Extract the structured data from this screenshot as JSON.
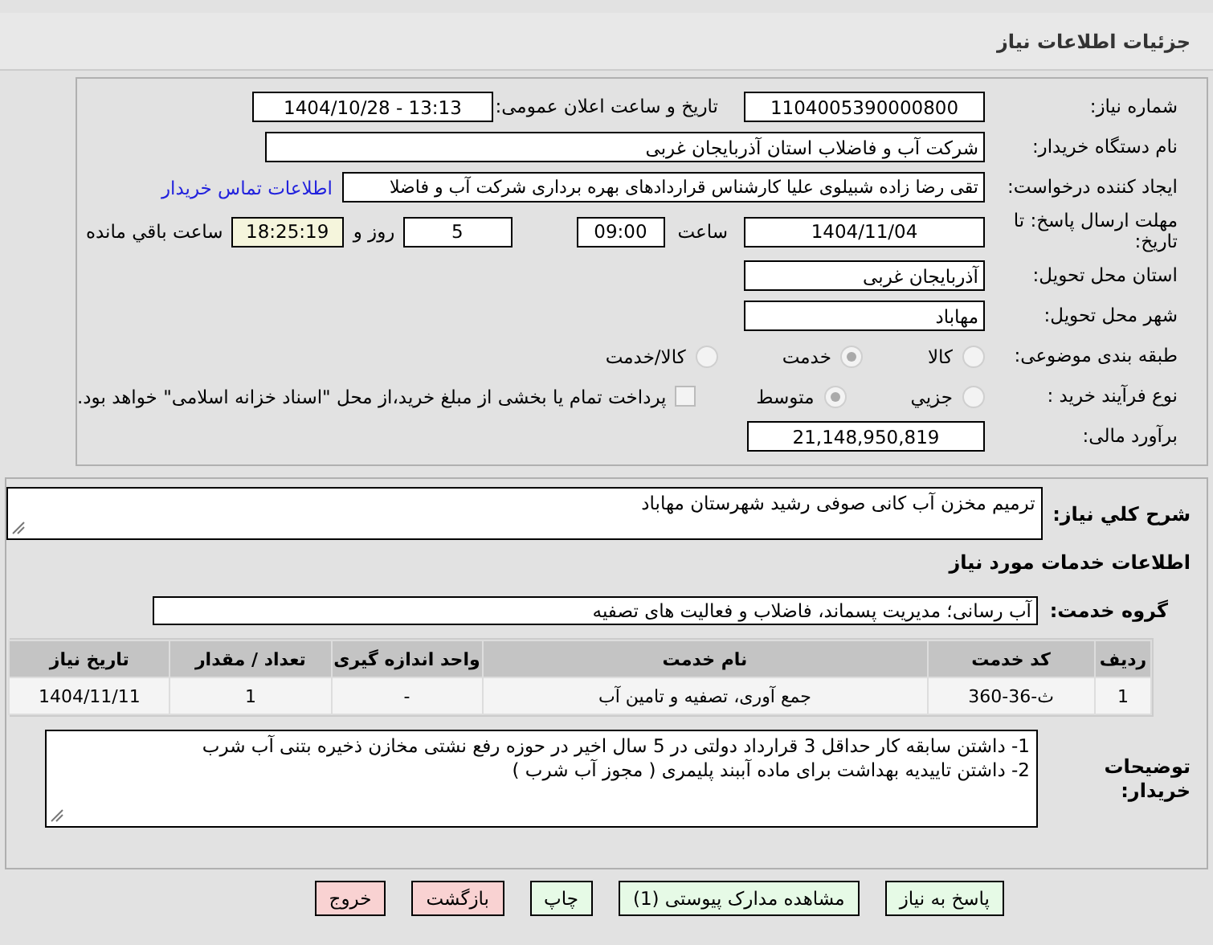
{
  "title": "جزئیات اطلاعات نیاز",
  "details": {
    "need_number": {
      "label": "شماره نیاز:",
      "value": "1104005390000800"
    },
    "announce": {
      "label": "تاریخ و ساعت اعلان عمومی:",
      "value": "1404/10/28 - 13:13"
    },
    "buyer": {
      "label": "نام دستگاه خریدار:",
      "value": "شرکت آب و فاضلاب استان آذربایجان غربی"
    },
    "creator": {
      "label": "ایجاد کننده درخواست:",
      "value": "تقی رضا زاده شبیلوی علیا کارشناس قراردادهای بهره برداری شرکت آب و فاضلا",
      "link": "اطلاعات تماس خریدار"
    },
    "deadline": {
      "label": "مهلت ارسال پاسخ: تا تاریخ:",
      "date": "1404/11/04",
      "time_label": "ساعت",
      "time": "09:00",
      "days": "5",
      "days_label": "روز و",
      "remaining": "18:25:19",
      "remaining_label": "ساعت باقي مانده"
    },
    "province": {
      "label": "استان محل تحویل:",
      "value": "آذربایجان غربی"
    },
    "city": {
      "label": "شهر محل تحویل:",
      "value": "مهاباد"
    },
    "category": {
      "label": "طبقه بندی موضوعی:",
      "options": [
        {
          "label": "کالا",
          "selected": false
        },
        {
          "label": "خدمت",
          "selected": true
        },
        {
          "label": "کالا/خدمت",
          "selected": false
        }
      ]
    },
    "process": {
      "label": "نوع فرآیند خرید :",
      "options": [
        {
          "label": "جزیي",
          "selected": false
        },
        {
          "label": "متوسط",
          "selected": true
        }
      ],
      "payment": {
        "checked": false,
        "text": "پرداخت تمام یا بخشی از مبلغ خرید،از محل \"اسناد خزانه اسلامی\" خواهد بود."
      }
    },
    "estimate": {
      "label": "برآورد مالی:",
      "value": "21,148,950,819"
    }
  },
  "summary": {
    "label": "شرح کلي نیاز:",
    "value": "ترمیم مخزن آب کانی صوفی رشید شهرستان مهاباد"
  },
  "services_heading": "اطلاعات خدمات مورد نیاز",
  "service_group": {
    "label": "گروه خدمت:",
    "value": "آب رسانی؛ مدیریت پسماند، فاضلاب و فعالیت های تصفیه"
  },
  "table": {
    "columns": [
      "ردیف",
      "کد خدمت",
      "نام خدمت",
      "واحد اندازه گیری",
      "تعداد / مقدار",
      "تاریخ نیاز"
    ],
    "rows": [
      [
        "1",
        "ث-36-360",
        "جمع آوری، تصفیه و تامین آب",
        "-",
        "1",
        "1404/11/11"
      ]
    ]
  },
  "notes": {
    "label": "توضیحات خریدار:",
    "lines": [
      "1- داشتن سابقه کار حداقل 3 قرارداد دولتی در 5 سال اخیر در حوزه رفع نشتی مخازن ذخیره بتنی آب شرب",
      "2- داشتن تاییدیه بهداشت برای ماده آببند پلیمری ( مجوز آب شرب )"
    ]
  },
  "buttons": [
    {
      "label": "پاسخ به نیاز",
      "kind": "primary"
    },
    {
      "label": "مشاهده مدارک پیوستی (1)",
      "kind": "primary"
    },
    {
      "label": "چاپ",
      "kind": "primary"
    },
    {
      "label": "بازگشت",
      "kind": "danger"
    },
    {
      "label": "خروج",
      "kind": "danger"
    }
  ]
}
